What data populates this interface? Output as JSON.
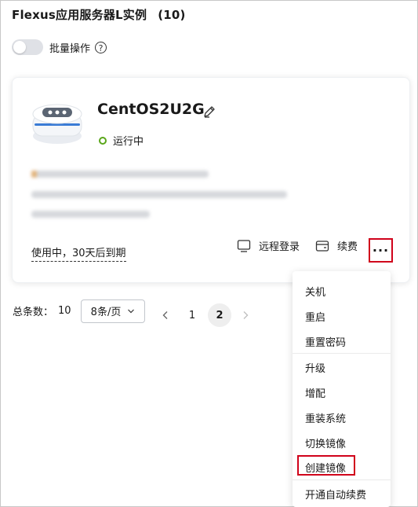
{
  "header": {
    "title": "Flexus应用服务器L实例",
    "count": "(10)"
  },
  "batch": {
    "label": "批量操作",
    "help": "?"
  },
  "instance": {
    "name": "CentOS2U2G",
    "status": "运行中",
    "expiry": "使用中，30天后到期",
    "remote_login": "远程登录",
    "renew": "续费",
    "more": "···"
  },
  "pagination": {
    "total_label": "总条数：",
    "total": "10",
    "page_size": "8条/页",
    "pages": [
      "1",
      "2"
    ],
    "current": "2"
  },
  "more_menu": {
    "items": [
      "关机",
      "重启",
      "重置密码",
      "升级",
      "增配",
      "重装系统",
      "切换镜像",
      "创建镜像",
      "开通自动续费"
    ],
    "highlighted": "创建镜像"
  },
  "colors": {
    "status_ok": "#5aa61a",
    "highlight_border": "#d0021b",
    "server_accent": "#3a7bd5"
  }
}
